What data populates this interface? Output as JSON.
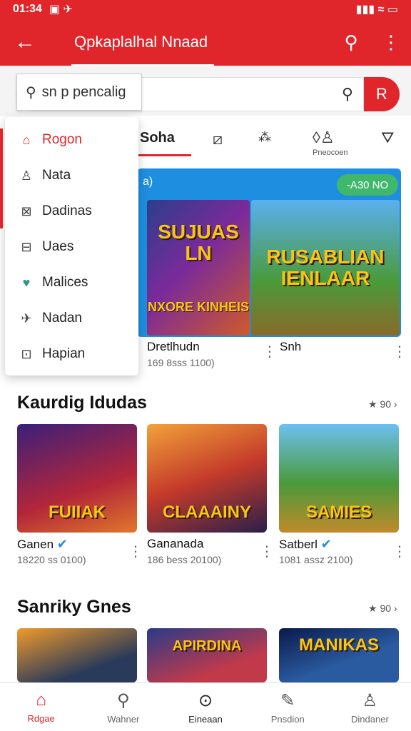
{
  "status": {
    "time": "01:34",
    "left_icons": "▣ ✈",
    "right_icons": "▮▮▮ ≈ ▭"
  },
  "appbar": {
    "title": "Qpkaplalhal Nnaad",
    "back_icon": "←",
    "profile_icon": "⚲",
    "more_icon": "⋮"
  },
  "search": {
    "value": "sn p pencalig",
    "placeholder": "sn p pencalig",
    "button_label": "R"
  },
  "tabs": {
    "active": "Soha",
    "extra_label": "Pneocoen"
  },
  "menu": {
    "items": [
      {
        "label": "Rogon",
        "icon": "⌂"
      },
      {
        "label": "Nata",
        "icon": "♙"
      },
      {
        "label": "Dadinas",
        "icon": "⊠"
      },
      {
        "label": "Uaes",
        "icon": "⊟"
      },
      {
        "label": "Malices",
        "icon": "♥"
      },
      {
        "label": "Nadan",
        "icon": "✈"
      },
      {
        "label": "Hapian",
        "icon": "⊡"
      }
    ]
  },
  "banner": {
    "badge": "-A30 NO",
    "corner": "a)",
    "game1": {
      "title": "SUJUAS LN",
      "sub": "NXORE KINHEIS"
    },
    "game2": {
      "title": "RUSABLIAN IENLAAR"
    }
  },
  "featured": {
    "card1": {
      "title": "Dretlhudn",
      "sub": "169 8sss 1100)"
    },
    "card2": {
      "title": "Snh"
    }
  },
  "section1": {
    "title": "Kaurdig Idudas",
    "see_all": "★ 90 ›",
    "cards": [
      {
        "name": "Ganen",
        "sub": "18220 ss 0100)",
        "art": "FUIIAK",
        "verified": true
      },
      {
        "name": "Gananada",
        "sub": "186 bess 20100)",
        "art": "CLAAAINY",
        "verified": false
      },
      {
        "name": "Satberl",
        "sub": "1081 assz 2100)",
        "art": "SAMIES",
        "verified": true
      }
    ]
  },
  "section2": {
    "title": "Sanriky Gnes",
    "see_all": "★ 90 ›",
    "cards": [
      {
        "art": ""
      },
      {
        "art": "APIRDINA"
      },
      {
        "art": "MANIKAS"
      }
    ]
  },
  "bottom_nav": [
    {
      "label": "Rdgae",
      "icon": "⌂"
    },
    {
      "label": "Wahner",
      "icon": "⚲"
    },
    {
      "label": "Eineaan",
      "icon": "⊙"
    },
    {
      "label": "Pnsdion",
      "icon": "✎"
    },
    {
      "label": "Dindaner",
      "icon": "♙"
    }
  ],
  "colors": {
    "accent": "#e0262b",
    "badge": "#3fb86b",
    "banner_bg": "#1e8ee0",
    "verified": "#1e8ee0"
  }
}
